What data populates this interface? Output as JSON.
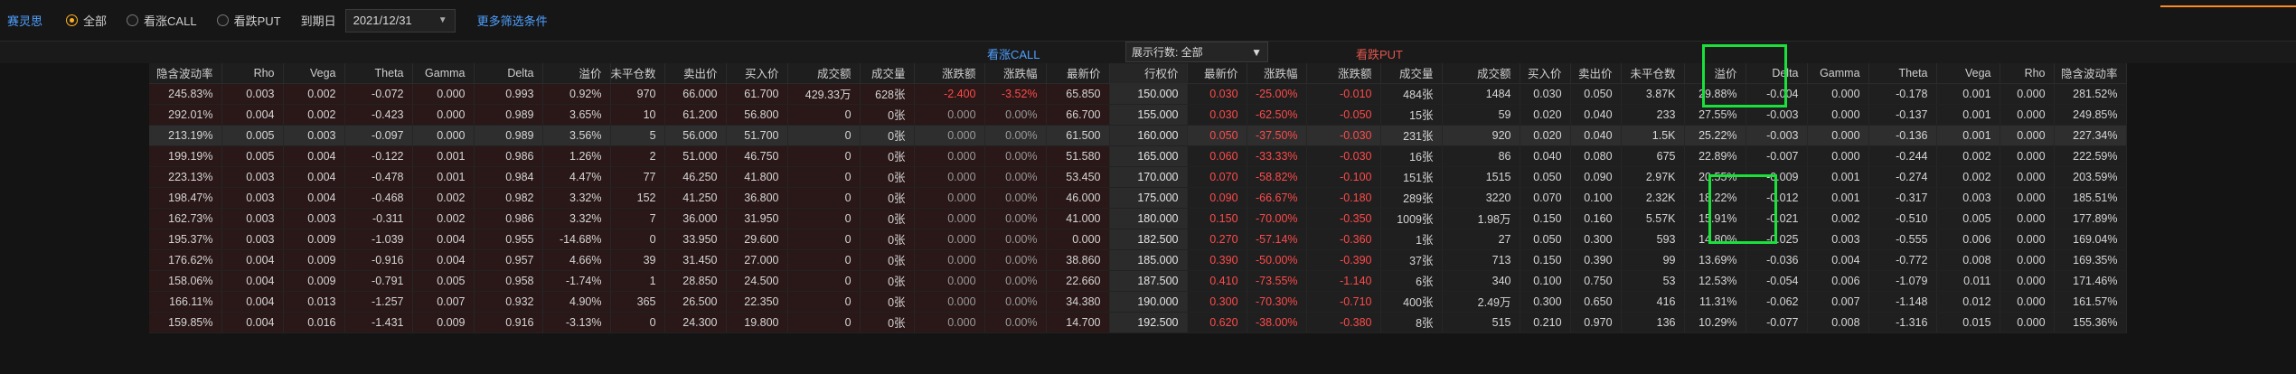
{
  "header": {
    "app_title": "赛灵思",
    "filters": [
      {
        "label": "全部",
        "selected": true
      },
      {
        "label": "看涨CALL",
        "selected": false
      },
      {
        "label": "看跌PUT",
        "selected": false
      }
    ],
    "expiry_label": "到期日",
    "expiry_value": "2021/12/31",
    "more_filters": "更多筛选条件"
  },
  "section": {
    "call_title": "看涨CALL",
    "put_title": "看跌PUT",
    "rows_select": "展示行数: 全部"
  },
  "columns": {
    "call": [
      "隐含波动率",
      "Rho",
      "Vega",
      "Theta",
      "Gamma",
      "Delta",
      "溢价",
      "未平仓数",
      "卖出价",
      "买入价",
      "成交额",
      "成交量",
      "涨跌额",
      "涨跌幅",
      "最新价"
    ],
    "strike": "行权价",
    "put": [
      "最新价",
      "涨跌幅",
      "涨跌额",
      "成交量",
      "成交额",
      "买入价",
      "卖出价",
      "未平仓数",
      "溢价",
      "Delta",
      "Gamma",
      "Theta",
      "Vega",
      "Rho",
      "隐含波动率"
    ]
  },
  "rows": [
    {
      "call": [
        "245.83%",
        "0.003",
        "0.002",
        "-0.072",
        "0.000",
        "0.993",
        "0.92%",
        "970",
        "66.000",
        "61.700",
        "429.33万",
        "628张",
        "-2.400",
        "-3.52%",
        "65.850"
      ],
      "strike": "150.000",
      "put": [
        "0.030",
        "-25.00%",
        "-0.010",
        "484张",
        "1484",
        "0.030",
        "0.050",
        "3.87K",
        "29.88%",
        "-0.004",
        "0.000",
        "-0.178",
        "0.001",
        "0.000",
        "281.52%"
      ]
    },
    {
      "call": [
        "292.01%",
        "0.004",
        "0.002",
        "-0.423",
        "0.000",
        "0.989",
        "3.65%",
        "10",
        "61.200",
        "56.800",
        "0",
        "0张",
        "0.000",
        "0.00%",
        "66.700"
      ],
      "strike": "155.000",
      "put": [
        "0.030",
        "-62.50%",
        "-0.050",
        "15张",
        "59",
        "0.020",
        "0.040",
        "233",
        "27.55%",
        "-0.003",
        "0.000",
        "-0.137",
        "0.001",
        "0.000",
        "249.85%"
      ]
    },
    {
      "call": [
        "213.19%",
        "0.005",
        "0.003",
        "-0.097",
        "0.000",
        "0.989",
        "3.56%",
        "5",
        "56.000",
        "51.700",
        "0",
        "0张",
        "0.000",
        "0.00%",
        "61.500"
      ],
      "strike": "160.000",
      "put": [
        "0.050",
        "-37.50%",
        "-0.030",
        "231张",
        "920",
        "0.020",
        "0.040",
        "1.5K",
        "25.22%",
        "-0.003",
        "0.000",
        "-0.136",
        "0.001",
        "0.000",
        "227.34%"
      ]
    },
    {
      "call": [
        "199.19%",
        "0.005",
        "0.004",
        "-0.122",
        "0.001",
        "0.986",
        "1.26%",
        "2",
        "51.000",
        "46.750",
        "0",
        "0张",
        "0.000",
        "0.00%",
        "51.580"
      ],
      "strike": "165.000",
      "put": [
        "0.060",
        "-33.33%",
        "-0.030",
        "16张",
        "86",
        "0.040",
        "0.080",
        "675",
        "22.89%",
        "-0.007",
        "0.000",
        "-0.244",
        "0.002",
        "0.000",
        "222.59%"
      ]
    },
    {
      "call": [
        "223.13%",
        "0.003",
        "0.004",
        "-0.478",
        "0.001",
        "0.984",
        "4.47%",
        "77",
        "46.250",
        "41.800",
        "0",
        "0张",
        "0.000",
        "0.00%",
        "53.450"
      ],
      "strike": "170.000",
      "put": [
        "0.070",
        "-58.82%",
        "-0.100",
        "151张",
        "1515",
        "0.050",
        "0.090",
        "2.97K",
        "20.55%",
        "-0.009",
        "0.001",
        "-0.274",
        "0.002",
        "0.000",
        "203.59%"
      ]
    },
    {
      "call": [
        "198.47%",
        "0.003",
        "0.004",
        "-0.468",
        "0.002",
        "0.982",
        "3.32%",
        "152",
        "41.250",
        "36.800",
        "0",
        "0张",
        "0.000",
        "0.00%",
        "46.000"
      ],
      "strike": "175.000",
      "put": [
        "0.090",
        "-66.67%",
        "-0.180",
        "289张",
        "3220",
        "0.070",
        "0.100",
        "2.32K",
        "18.22%",
        "-0.012",
        "0.001",
        "-0.317",
        "0.003",
        "0.000",
        "185.51%"
      ]
    },
    {
      "call": [
        "162.73%",
        "0.003",
        "0.003",
        "-0.311",
        "0.002",
        "0.986",
        "3.32%",
        "7",
        "36.000",
        "31.950",
        "0",
        "0张",
        "0.000",
        "0.00%",
        "41.000"
      ],
      "strike": "180.000",
      "put": [
        "0.150",
        "-70.00%",
        "-0.350",
        "1009张",
        "1.98万",
        "0.150",
        "0.160",
        "5.57K",
        "15.91%",
        "-0.021",
        "0.002",
        "-0.510",
        "0.005",
        "0.000",
        "177.89%"
      ]
    },
    {
      "call": [
        "195.37%",
        "0.003",
        "0.009",
        "-1.039",
        "0.004",
        "0.955",
        "-14.68%",
        "0",
        "33.950",
        "29.600",
        "0",
        "0张",
        "0.000",
        "0.00%",
        "0.000"
      ],
      "strike": "182.500",
      "put": [
        "0.270",
        "-57.14%",
        "-0.360",
        "1张",
        "27",
        "0.050",
        "0.300",
        "593",
        "14.80%",
        "-0.025",
        "0.003",
        "-0.555",
        "0.006",
        "0.000",
        "169.04%"
      ]
    },
    {
      "call": [
        "176.62%",
        "0.004",
        "0.009",
        "-0.916",
        "0.004",
        "0.957",
        "4.66%",
        "39",
        "31.450",
        "27.000",
        "0",
        "0张",
        "0.000",
        "0.00%",
        "38.860"
      ],
      "strike": "185.000",
      "put": [
        "0.390",
        "-50.00%",
        "-0.390",
        "37张",
        "713",
        "0.150",
        "0.390",
        "99",
        "13.69%",
        "-0.036",
        "0.004",
        "-0.772",
        "0.008",
        "0.000",
        "169.35%"
      ]
    },
    {
      "call": [
        "158.06%",
        "0.004",
        "0.009",
        "-0.791",
        "0.005",
        "0.958",
        "-1.74%",
        "1",
        "28.850",
        "24.500",
        "0",
        "0张",
        "0.000",
        "0.00%",
        "22.660"
      ],
      "strike": "187.500",
      "put": [
        "0.410",
        "-73.55%",
        "-1.140",
        "6张",
        "340",
        "0.100",
        "0.750",
        "53",
        "12.53%",
        "-0.054",
        "0.006",
        "-1.079",
        "0.011",
        "0.000",
        "171.46%"
      ]
    },
    {
      "call": [
        "166.11%",
        "0.004",
        "0.013",
        "-1.257",
        "0.007",
        "0.932",
        "4.90%",
        "365",
        "26.500",
        "22.350",
        "0",
        "0张",
        "0.000",
        "0.00%",
        "34.380"
      ],
      "strike": "190.000",
      "put": [
        "0.300",
        "-70.30%",
        "-0.710",
        "400张",
        "2.49万",
        "0.300",
        "0.650",
        "416",
        "11.31%",
        "-0.062",
        "0.007",
        "-1.148",
        "0.012",
        "0.000",
        "161.57%"
      ]
    },
    {
      "call": [
        "159.85%",
        "0.004",
        "0.016",
        "-1.431",
        "0.009",
        "0.916",
        "-3.13%",
        "0",
        "24.300",
        "19.800",
        "0",
        "0张",
        "0.000",
        "0.00%",
        "14.700"
      ],
      "strike": "192.500",
      "put": [
        "0.620",
        "-38.00%",
        "-0.380",
        "8张",
        "515",
        "0.210",
        "0.970",
        "136",
        "10.29%",
        "-0.077",
        "0.008",
        "-1.316",
        "0.015",
        "0.000",
        "155.36%"
      ]
    }
  ],
  "colors": {
    "red": "#ff4a4a",
    "call_bg": "#2a1717",
    "highlight": "#19e03a",
    "link": "#4ea0ff",
    "accent": "#ffb020"
  }
}
